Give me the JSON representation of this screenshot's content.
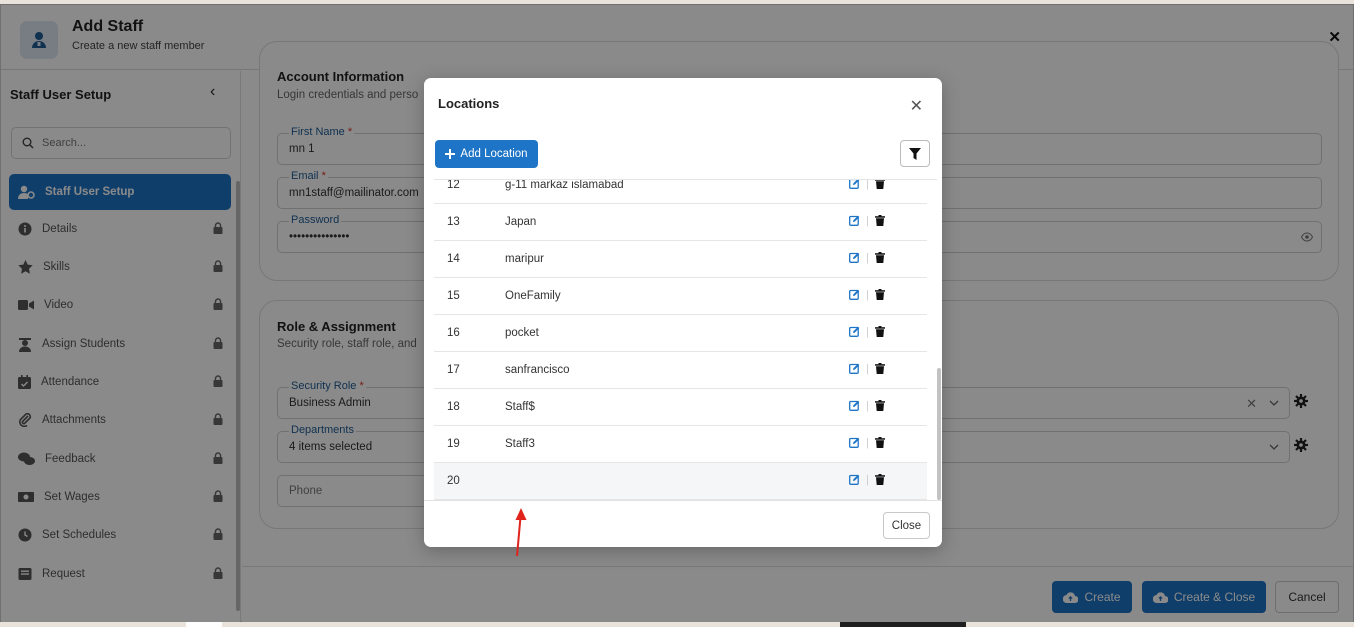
{
  "header": {
    "title": "Add Staff",
    "subtitle": "Create a new staff member"
  },
  "sidebar": {
    "title": "Staff User Setup",
    "search_placeholder": "Search...",
    "active_label": "Staff User Setup",
    "items": [
      {
        "label": "Details",
        "icon": "info-icon"
      },
      {
        "label": "Skills",
        "icon": "star-icon"
      },
      {
        "label": "Video",
        "icon": "video-icon"
      },
      {
        "label": "Assign Students",
        "icon": "graduate-icon"
      },
      {
        "label": "Attendance",
        "icon": "calendar-check-icon"
      },
      {
        "label": "Attachments",
        "icon": "paperclip-icon"
      },
      {
        "label": "Feedback",
        "icon": "comments-icon"
      },
      {
        "label": "Set Wages",
        "icon": "money-icon"
      },
      {
        "label": "Set Schedules",
        "icon": "clock-icon"
      },
      {
        "label": "Request",
        "icon": "inbox-icon"
      }
    ]
  },
  "account": {
    "title": "Account Information",
    "subtitle": "Login credentials and perso",
    "first_name_label": "First Name",
    "first_name_value": "mn 1",
    "email_label": "Email",
    "email_value": "mn1staff@mailinator.com",
    "password_label": "Password",
    "password_value": "•••••••••••••••"
  },
  "role": {
    "title": "Role & Assignment",
    "subtitle": "Security role, staff role, and",
    "security_role_label": "Security Role",
    "security_role_value": "Business Admin",
    "departments_label": "Departments",
    "departments_value": "4 items selected",
    "phone_placeholder": "Phone"
  },
  "footer": {
    "create": "Create",
    "create_close": "Create & Close",
    "cancel": "Cancel"
  },
  "modal": {
    "title": "Locations",
    "add_label": "Add Location",
    "close_label": "Close",
    "rows": [
      {
        "num": "12",
        "name": "g-11 markaz islamabad"
      },
      {
        "num": "13",
        "name": "Japan"
      },
      {
        "num": "14",
        "name": "maripur"
      },
      {
        "num": "15",
        "name": "OneFamily"
      },
      {
        "num": "16",
        "name": "pocket"
      },
      {
        "num": "17",
        "name": "sanfrancisco"
      },
      {
        "num": "18",
        "name": "Staff$"
      },
      {
        "num": "19",
        "name": "Staff3"
      },
      {
        "num": "20",
        "name": ""
      }
    ]
  },
  "colors": {
    "primary": "#1e74c6",
    "label_blue": "#1e5b94",
    "required": "#d9342b",
    "annotation_arrow": "#e0241b"
  }
}
